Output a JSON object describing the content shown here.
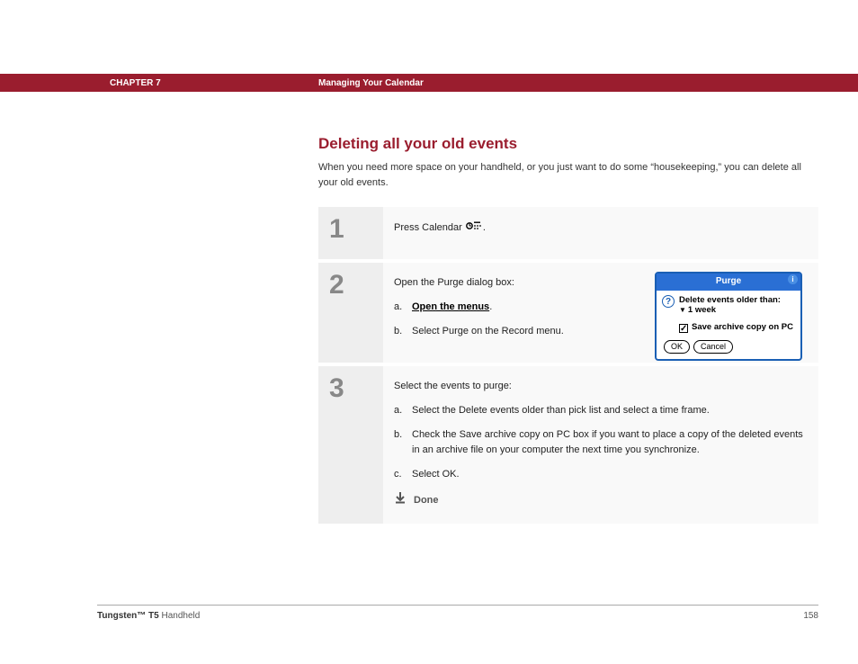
{
  "header": {
    "chapter": "CHAPTER 7",
    "title": "Managing Your Calendar"
  },
  "section": {
    "heading": "Deleting all your old events",
    "intro": "When you need more space on your handheld, or you just want to do some “housekeeping,” you can delete all your old events."
  },
  "steps": [
    {
      "num": "1",
      "lead": "Press Calendar ",
      "trail": "."
    },
    {
      "num": "2",
      "lead": "Open the Purge dialog box:",
      "subs": [
        {
          "marker": "a.",
          "text": "Open the menus",
          "link": true,
          "trail": "."
        },
        {
          "marker": "b.",
          "text": "Select Purge on the Record menu."
        }
      ]
    },
    {
      "num": "3",
      "lead": "Select the events to purge:",
      "subs": [
        {
          "marker": "a.",
          "text": "Select the Delete events older than pick list and select a time frame."
        },
        {
          "marker": "b.",
          "text": "Check the Save archive copy on PC box if you want to place a copy of the deleted events in an archive file on your computer the next time you synchronize."
        },
        {
          "marker": "c.",
          "text": "Select OK."
        }
      ],
      "done": "Done"
    }
  ],
  "dialog": {
    "title": "Purge",
    "info": "i",
    "question": "?",
    "line1": "Delete events older than:",
    "dropdown_value": "1 week",
    "checkbox_label": "Save archive copy on PC",
    "ok": "OK",
    "cancel": "Cancel"
  },
  "footer": {
    "brand_bold": "Tungsten™ T5",
    "brand_rest": " Handheld",
    "page": "158"
  }
}
